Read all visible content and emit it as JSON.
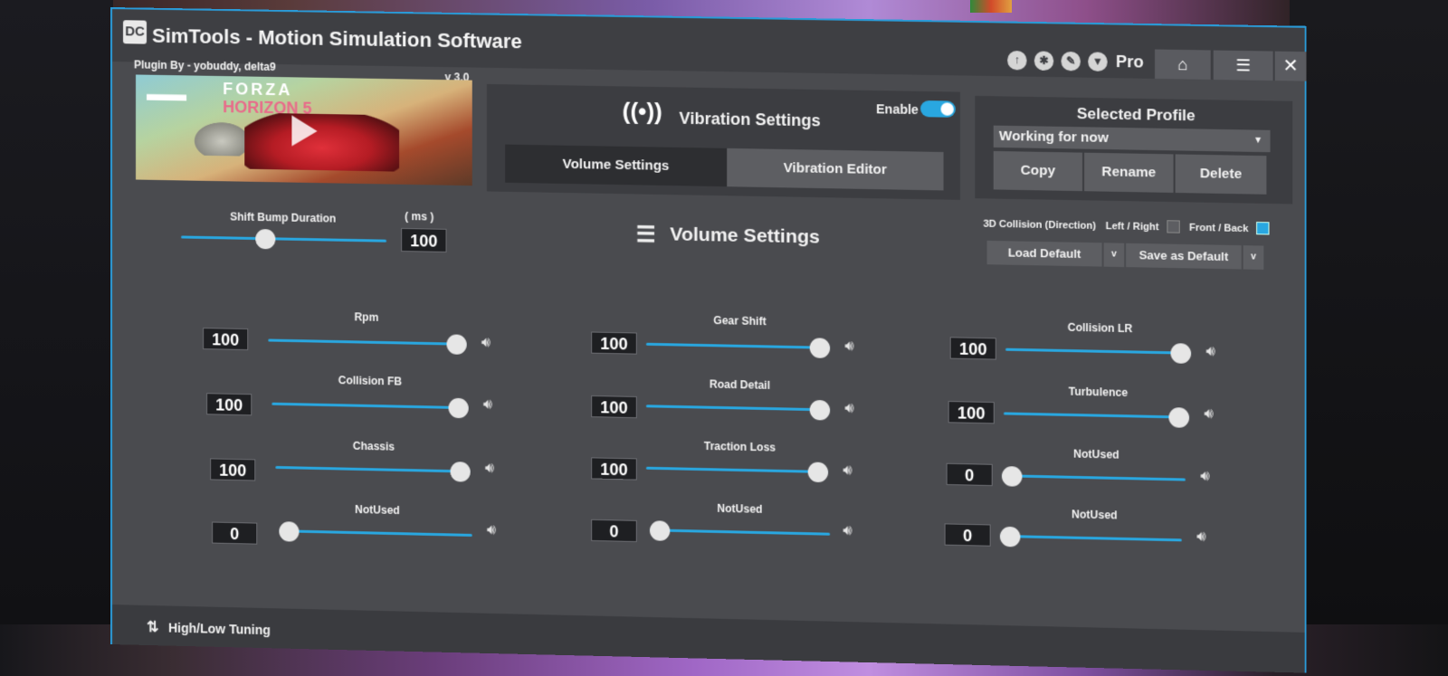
{
  "window": {
    "app_title": "SimTools - Motion Simulation Software",
    "logo_text": "DC",
    "toolbar_icons": [
      "up-arrow-icon",
      "settings-icon",
      "wrench-icon",
      "shield-icon"
    ],
    "pro_label": "Pro",
    "home_icon": "⌂",
    "menu_icon": "☰",
    "close_icon": "✕"
  },
  "plugin": {
    "author": "Plugin By - yobuddy, delta9",
    "version": "v 3.0",
    "banner": {
      "line1": "FORZA",
      "line2": "HORIZON 5"
    }
  },
  "vibration": {
    "title": "Vibration Settings",
    "enable_label": "Enable",
    "enabled": true,
    "tabs": [
      "Volume Settings",
      "Vibration Editor"
    ],
    "active_tab": 0
  },
  "profile": {
    "title": "Selected Profile",
    "selected": "Working for now",
    "buttons": [
      "Copy",
      "Rename",
      "Delete"
    ]
  },
  "shift_bump": {
    "label": "Shift Bump Duration",
    "unit": "( ms )",
    "value": "100",
    "slider_fraction": 0.4
  },
  "volume_settings": {
    "title": "Volume Settings",
    "collision_direction_label": "3D Collision (Direction)",
    "left_right_label": "Left / Right",
    "left_right_checked": false,
    "front_back_label": "Front / Back",
    "front_back_checked": true,
    "load_default": "Load Default",
    "save_default": "Save as Default",
    "caret": "v"
  },
  "channels": [
    {
      "name": "Rpm",
      "value": "100",
      "level": 1.0
    },
    {
      "name": "Gear Shift",
      "value": "100",
      "level": 1.0
    },
    {
      "name": "Collision LR",
      "value": "100",
      "level": 1.0
    },
    {
      "name": "Collision FB",
      "value": "100",
      "level": 1.0
    },
    {
      "name": "Road Detail",
      "value": "100",
      "level": 1.0
    },
    {
      "name": "Turbulence",
      "value": "100",
      "level": 1.0
    },
    {
      "name": "Chassis",
      "value": "100",
      "level": 1.0
    },
    {
      "name": "Traction Loss",
      "value": "100",
      "level": 1.0
    },
    {
      "name": "NotUsed",
      "value": "0",
      "level": 0.0
    },
    {
      "name": "NotUsed",
      "value": "0",
      "level": 0.0
    },
    {
      "name": "NotUsed",
      "value": "0",
      "level": 0.0
    },
    {
      "name": "NotUsed",
      "value": "0",
      "level": 0.0
    }
  ],
  "bottom": {
    "label": "High/Low Tuning",
    "icon": "⇅"
  },
  "colors": {
    "accent": "#29a7e0",
    "window_bg": "#4a4b4f",
    "panel_bg": "#3c3d41"
  }
}
